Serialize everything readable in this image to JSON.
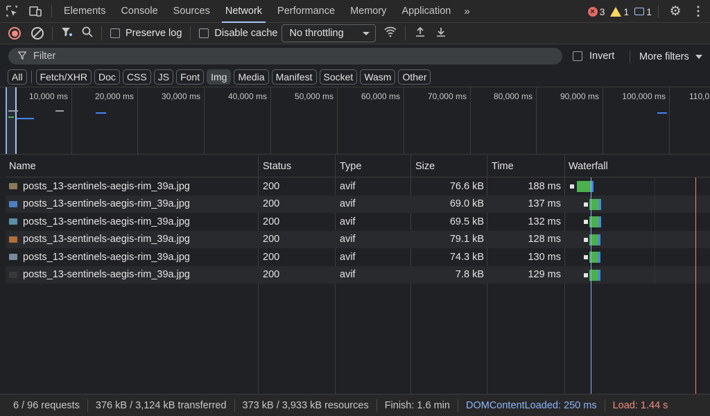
{
  "tabs": {
    "items": [
      "Elements",
      "Console",
      "Sources",
      "Network",
      "Performance",
      "Memory",
      "Application"
    ],
    "active": "Network",
    "more": "»"
  },
  "issues": {
    "errors": "3",
    "warnings": "1",
    "messages": "1"
  },
  "toolbar": {
    "preserve_log": "Preserve log",
    "disable_cache": "Disable cache",
    "throttling": "No throttling"
  },
  "filter": {
    "placeholder": "Filter",
    "invert": "Invert",
    "more_filters": "More filters"
  },
  "type_chips": {
    "items": [
      "All",
      "Fetch/XHR",
      "Doc",
      "CSS",
      "JS",
      "Font",
      "Img",
      "Media",
      "Manifest",
      "Socket",
      "Wasm",
      "Other"
    ],
    "selected": "Img"
  },
  "overview": {
    "ticks": [
      "10,000 ms",
      "20,000 ms",
      "30,000 ms",
      "40,000 ms",
      "50,000 ms",
      "60,000 ms",
      "70,000 ms",
      "80,000 ms",
      "90,000 ms",
      "100,000 ms",
      "110,0"
    ]
  },
  "table": {
    "columns": [
      "Name",
      "Status",
      "Type",
      "Size",
      "Time",
      "Waterfall"
    ],
    "rows": [
      {
        "name": "posts_13-sentinels-aegis-rim_39a.jpg",
        "status": "200",
        "type": "avif",
        "size": "76.6 kB",
        "time": "188 ms",
        "thumb_color": "#8a7a5a"
      },
      {
        "name": "posts_13-sentinels-aegis-rim_39a.jpg",
        "status": "200",
        "type": "avif",
        "size": "69.0 kB",
        "time": "137 ms",
        "thumb_color": "#4a7fc0"
      },
      {
        "name": "posts_13-sentinels-aegis-rim_39a.jpg",
        "status": "200",
        "type": "avif",
        "size": "69.5 kB",
        "time": "132 ms",
        "thumb_color": "#5b8fa8"
      },
      {
        "name": "posts_13-sentinels-aegis-rim_39a.jpg",
        "status": "200",
        "type": "avif",
        "size": "79.1 kB",
        "time": "128 ms",
        "thumb_color": "#b0703a"
      },
      {
        "name": "posts_13-sentinels-aegis-rim_39a.jpg",
        "status": "200",
        "type": "avif",
        "size": "74.3 kB",
        "time": "130 ms",
        "thumb_color": "#7a8a9a"
      },
      {
        "name": "posts_13-sentinels-aegis-rim_39a.jpg",
        "status": "200",
        "type": "avif",
        "size": "7.8 kB",
        "time": "129 ms",
        "thumb_color": "#3a3a3a"
      }
    ]
  },
  "status_bar": {
    "requests": "6 / 96 requests",
    "transferred": "376 kB / 3,124 kB transferred",
    "resources": "373 kB / 3,933 kB resources",
    "finish": "Finish: 1.6 min",
    "dom_content_loaded": "DOMContentLoaded: 250 ms",
    "load": "Load: 1.44 s"
  },
  "colors": {
    "accent": "#a8c7fa",
    "dcl_line": "#8ab4f8",
    "load_line": "#f28b82",
    "wf_green": "#4caf50",
    "wf_blue": "#4285f4"
  }
}
